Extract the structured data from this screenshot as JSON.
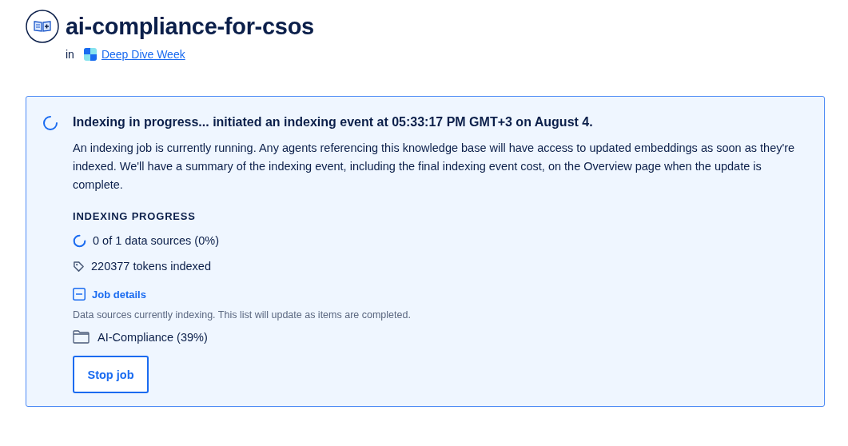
{
  "header": {
    "title": "ai-compliance-for-csos",
    "prefix": "in",
    "workspace_link": "Deep Dive Week"
  },
  "panel": {
    "heading": "Indexing in progress... initiated an indexing event at 05:33:17 PM GMT+3 on August 4.",
    "description": "An indexing job is currently running. Any agents referencing this knowledge base will have access to updated embeddings as soon as they're indexed. We'll have a summary of the indexing event, including the final indexing event cost, on the Overview page when the update is complete.",
    "progress_label": "INDEXING PROGRESS",
    "stats": [
      {
        "kind": "spinner",
        "text": "0 of 1 data sources (0%)"
      },
      {
        "kind": "tag",
        "text": "220377 tokens indexed"
      }
    ],
    "job_details": {
      "label": "Job details",
      "expanded": true,
      "note": "Data sources currently indexing. This list will update as items are completed.",
      "sources": [
        "AI-Compliance (39%)"
      ]
    },
    "button": "Stop job"
  }
}
